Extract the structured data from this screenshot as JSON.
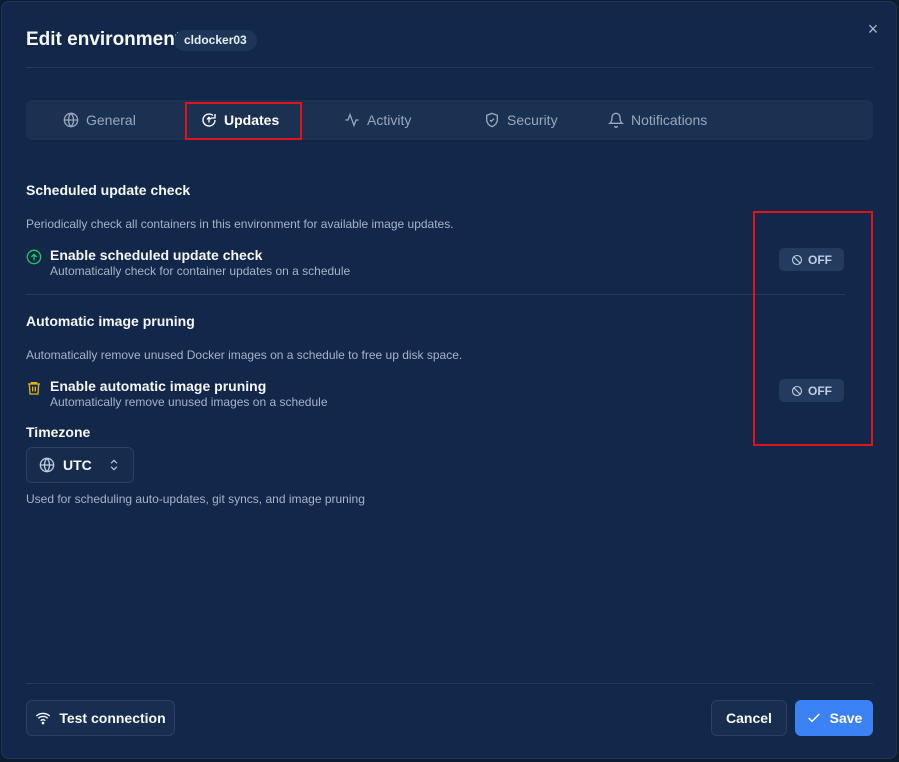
{
  "header": {
    "title": "Edit environment",
    "environment_badge": "cldocker03",
    "close_label": "×"
  },
  "tabs": [
    {
      "label": "General",
      "icon": "globe-icon"
    },
    {
      "label": "Updates",
      "icon": "update-icon",
      "active": true
    },
    {
      "label": "Activity",
      "icon": "activity-icon"
    },
    {
      "label": "Security",
      "icon": "shield-icon"
    },
    {
      "label": "Notifications",
      "icon": "bell-icon"
    }
  ],
  "scheduled_update": {
    "title": "Scheduled update check",
    "description": "Periodically check all containers in this environment for available image updates.",
    "setting_label": "Enable scheduled update check",
    "setting_sub": "Automatically check for container updates on a schedule",
    "toggle_state": "OFF",
    "icon": "circle-arrow-up-icon"
  },
  "image_pruning": {
    "title": "Automatic image pruning",
    "description": "Automatically remove unused Docker images on a schedule to free up disk space.",
    "setting_label": "Enable automatic image pruning",
    "setting_sub": "Automatically remove unused images on a schedule",
    "toggle_state": "OFF",
    "icon": "trash-icon"
  },
  "timezone": {
    "label": "Timezone",
    "value": "UTC",
    "help": "Used for scheduling auto-updates, git syncs, and image pruning"
  },
  "footer": {
    "test_connection": "Test connection",
    "cancel": "Cancel",
    "save": "Save"
  },
  "colors": {
    "background": "#13274a",
    "accent": "#3b82f6",
    "success_icon": "#22c55e",
    "warning_icon": "#eab308",
    "highlight_box": "#e3131b"
  }
}
